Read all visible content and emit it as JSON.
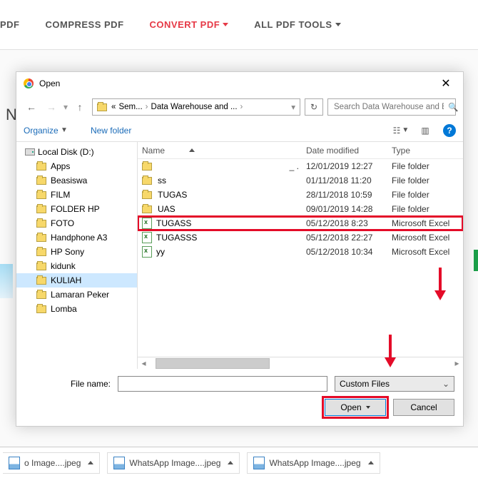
{
  "topbar": {
    "items": [
      {
        "label": "PDF",
        "partial": true
      },
      {
        "label": "COMPRESS PDF"
      },
      {
        "label": "CONVERT PDF",
        "active": true,
        "caret": true
      },
      {
        "label": "ALL PDF TOOLS",
        "caret": true
      }
    ]
  },
  "letter": "N",
  "dialog": {
    "title": "Open",
    "breadcrumb": {
      "root_sigil": "«",
      "segments": [
        "Sem...",
        "Data Warehouse and ..."
      ]
    },
    "search_placeholder": "Search Data Warehouse and B...",
    "toolbar": {
      "organize": "Organize",
      "newfolder": "New folder"
    },
    "tree": [
      {
        "label": "Local Disk (D:)",
        "type": "drive"
      },
      {
        "label": "Apps"
      },
      {
        "label": "Beasiswa"
      },
      {
        "label": "FILM"
      },
      {
        "label": "FOLDER HP"
      },
      {
        "label": "FOTO"
      },
      {
        "label": "Handphone A3"
      },
      {
        "label": "HP Sony"
      },
      {
        "label": "kidunk"
      },
      {
        "label": "KULIAH",
        "selected": true
      },
      {
        "label": "Lamaran Peker"
      },
      {
        "label": "Lomba"
      }
    ],
    "columns": {
      "name": "Name",
      "date": "Date modified",
      "type": "Type"
    },
    "files": [
      {
        "icon": "folder",
        "name": "",
        "trail": "_ .",
        "date": "12/01/2019 12:27",
        "type": "File folder"
      },
      {
        "icon": "folder",
        "name": "ss",
        "date": "01/11/2018 11:20",
        "type": "File folder"
      },
      {
        "icon": "folder",
        "name": "TUGAS",
        "date": "28/11/2018 10:59",
        "type": "File folder"
      },
      {
        "icon": "folder",
        "name": "UAS",
        "date": "09/01/2019 14:28",
        "type": "File folder"
      },
      {
        "icon": "excel",
        "name": "TUGASS",
        "date": "05/12/2018 8:23",
        "type": "Microsoft Excel",
        "highlight": true
      },
      {
        "icon": "excel",
        "name": "TUGASSS",
        "date": "05/12/2018 22:27",
        "type": "Microsoft Excel"
      },
      {
        "icon": "excel",
        "name": "yy",
        "date": "05/12/2018 10:34",
        "type": "Microsoft Excel"
      }
    ],
    "footer": {
      "filename_label": "File name:",
      "filetype_label": "Custom Files",
      "open_label": "Open",
      "cancel_label": "Cancel"
    }
  },
  "downloads": [
    {
      "label": "o Image....jpeg",
      "partial": true
    },
    {
      "label": "WhatsApp Image....jpeg"
    },
    {
      "label": "WhatsApp Image....jpeg"
    }
  ]
}
